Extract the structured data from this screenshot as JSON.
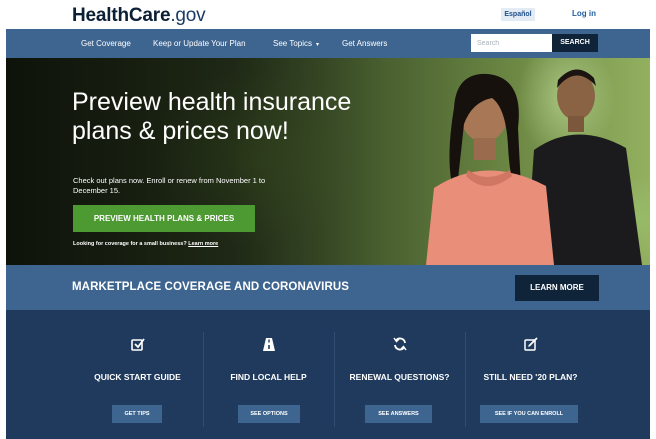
{
  "header": {
    "logo_health": "Health",
    "logo_care": "Care",
    "logo_gov": ".gov",
    "language_label": "Español",
    "login_label": "Log in"
  },
  "nav": {
    "items": [
      {
        "label": "Get Coverage"
      },
      {
        "label": "Keep or Update Your Plan"
      },
      {
        "label": "See Topics"
      },
      {
        "label": "Get Answers"
      }
    ],
    "search_placeholder": "Search",
    "search_button": "SEARCH"
  },
  "hero": {
    "title": "Preview health insurance plans & prices now!",
    "text": "Check out plans now. Enroll or renew from November 1 to December 15.",
    "cta": "PREVIEW HEALTH PLANS & PRICES",
    "small_text": "Looking for coverage for a small business?",
    "small_link": "Learn more"
  },
  "banner": {
    "title": "MARKETPLACE COVERAGE AND CORONAVIRUS",
    "button": "LEARN MORE"
  },
  "quick_links": [
    {
      "icon": "checkbox-icon",
      "title": "QUICK START GUIDE",
      "button": "GET TIPS"
    },
    {
      "icon": "road-icon",
      "title": "FIND LOCAL HELP",
      "button": "SEE OPTIONS"
    },
    {
      "icon": "refresh-icon",
      "title": "RENEWAL QUESTIONS?",
      "button": "SEE ANSWERS"
    },
    {
      "icon": "edit-icon",
      "title": "STILL NEED '20 PLAN?",
      "button": "SEE IF YOU CAN ENROLL"
    }
  ],
  "colors": {
    "nav_blue": "#3e6590",
    "dark_navy": "#0f2339",
    "links_bg": "#1f3a5c",
    "cta_green": "#4d9932"
  }
}
